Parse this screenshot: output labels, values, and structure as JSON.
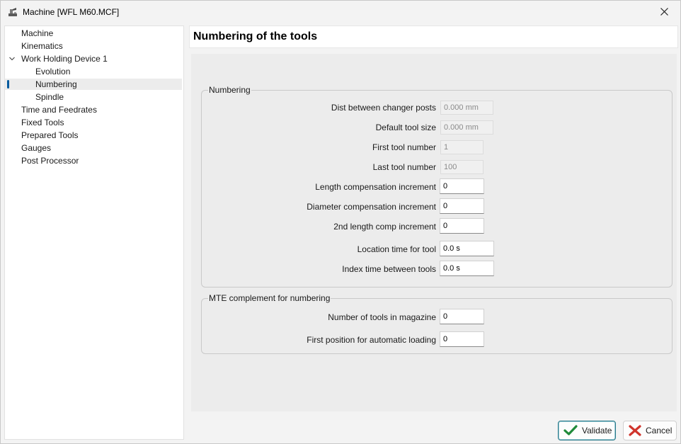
{
  "window": {
    "title": "Machine [WFL M60.MCF]"
  },
  "sidebar": {
    "items": [
      {
        "label": "Machine",
        "level": 0
      },
      {
        "label": "Kinematics",
        "level": 0
      },
      {
        "label": "Work Holding Device 1",
        "level": 0,
        "expanded": true
      },
      {
        "label": "Evolution",
        "level": 1
      },
      {
        "label": "Numbering",
        "level": 1,
        "selected": true
      },
      {
        "label": "Spindle",
        "level": 1
      },
      {
        "label": "Time and Feedrates",
        "level": 0
      },
      {
        "label": "Fixed Tools",
        "level": 0
      },
      {
        "label": "Prepared Tools",
        "level": 0
      },
      {
        "label": "Gauges",
        "level": 0
      },
      {
        "label": "Post Processor",
        "level": 0
      }
    ]
  },
  "page": {
    "title": "Numbering of the tools"
  },
  "numbering": {
    "legend": "Numbering",
    "fields": [
      {
        "label": "Dist between changer posts",
        "value": "0.000 mm",
        "readonly": true
      },
      {
        "label": "Default tool size",
        "value": "0.000 mm",
        "readonly": true
      },
      {
        "label": "First tool number",
        "value": "1",
        "readonly": true
      },
      {
        "label": "Last tool number",
        "value": "100",
        "readonly": true
      },
      {
        "label": "Length compensation increment",
        "value": "0",
        "readonly": false
      },
      {
        "label": "Diameter compensation increment",
        "value": "0",
        "readonly": false
      },
      {
        "label": "2nd length comp increment",
        "value": "0",
        "readonly": false
      },
      {
        "label": "Location time for tool",
        "value": "0.0 s",
        "readonly": false
      },
      {
        "label": "Index time between tools",
        "value": "0.0 s",
        "readonly": false
      }
    ]
  },
  "mte": {
    "legend": "MTE complement for numbering",
    "fields": [
      {
        "label": "Number of tools in magazine",
        "value": "0",
        "readonly": false
      },
      {
        "label": "First position for automatic loading",
        "value": "0",
        "readonly": false
      }
    ]
  },
  "footer": {
    "validate_label": "Validate",
    "cancel_label": "Cancel"
  },
  "colors": {
    "accent": "#005a9e",
    "validate_check": "#1f8a3a",
    "cancel_x": "#d0342c"
  }
}
